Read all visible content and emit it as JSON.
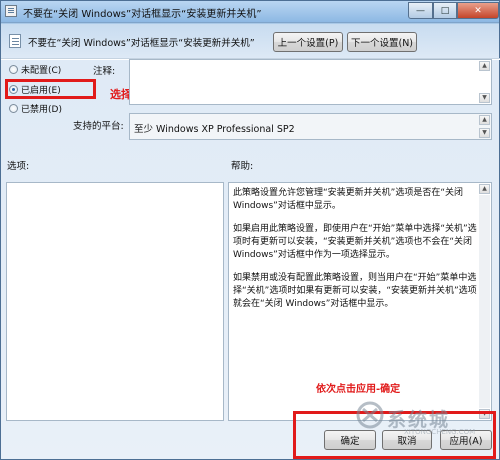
{
  "window": {
    "title": "不要在“关闭 Windows”对话框显示“安装更新并关机”",
    "minimize": "—",
    "maximize": "□",
    "close": "✕"
  },
  "header": {
    "title": "不要在“关闭 Windows”对话框显示“安装更新并关机”",
    "prev_label": "上一个设置(P)",
    "next_label": "下一个设置(N)"
  },
  "state": {
    "not_configured_label": "未配置(C)",
    "enabled_label": "已启用(E)",
    "disabled_label": "已禁用(D)",
    "selected": "enabled"
  },
  "comment": {
    "label": "注释:",
    "value": ""
  },
  "platform": {
    "label": "支持的平台:",
    "value": "至少 Windows XP Professional SP2"
  },
  "options": {
    "label": "选项:"
  },
  "help": {
    "label": "帮助:",
    "paragraphs": [
      "此策略设置允许您管理“安装更新并关机”选项是否在“关闭 Windows”对话框中显示。",
      "如果启用此策略设置，即使用户在“开始”菜单中选择“关机”选项时有更新可以安装，“安装更新并关机”选项也不会在“关闭 Windows”对话框中作为一项选择显示。",
      "如果禁用或没有配置此策略设置，则当用户在“开始”菜单中选择“关机”选项时如果有更新可以安装，“安装更新并关机”选项就会在“关闭 Windows”对话框中显示。"
    ]
  },
  "footer": {
    "ok_label": "确定",
    "cancel_label": "取消",
    "apply_label": "应用(A)"
  },
  "annotations": {
    "enabled_hint": "选择 已启用",
    "apply_hint": "依次点击应用-确定",
    "color": "#e11a1a"
  },
  "watermark": {
    "text": "系统城",
    "sub": "XITONGCHENG.COM"
  }
}
